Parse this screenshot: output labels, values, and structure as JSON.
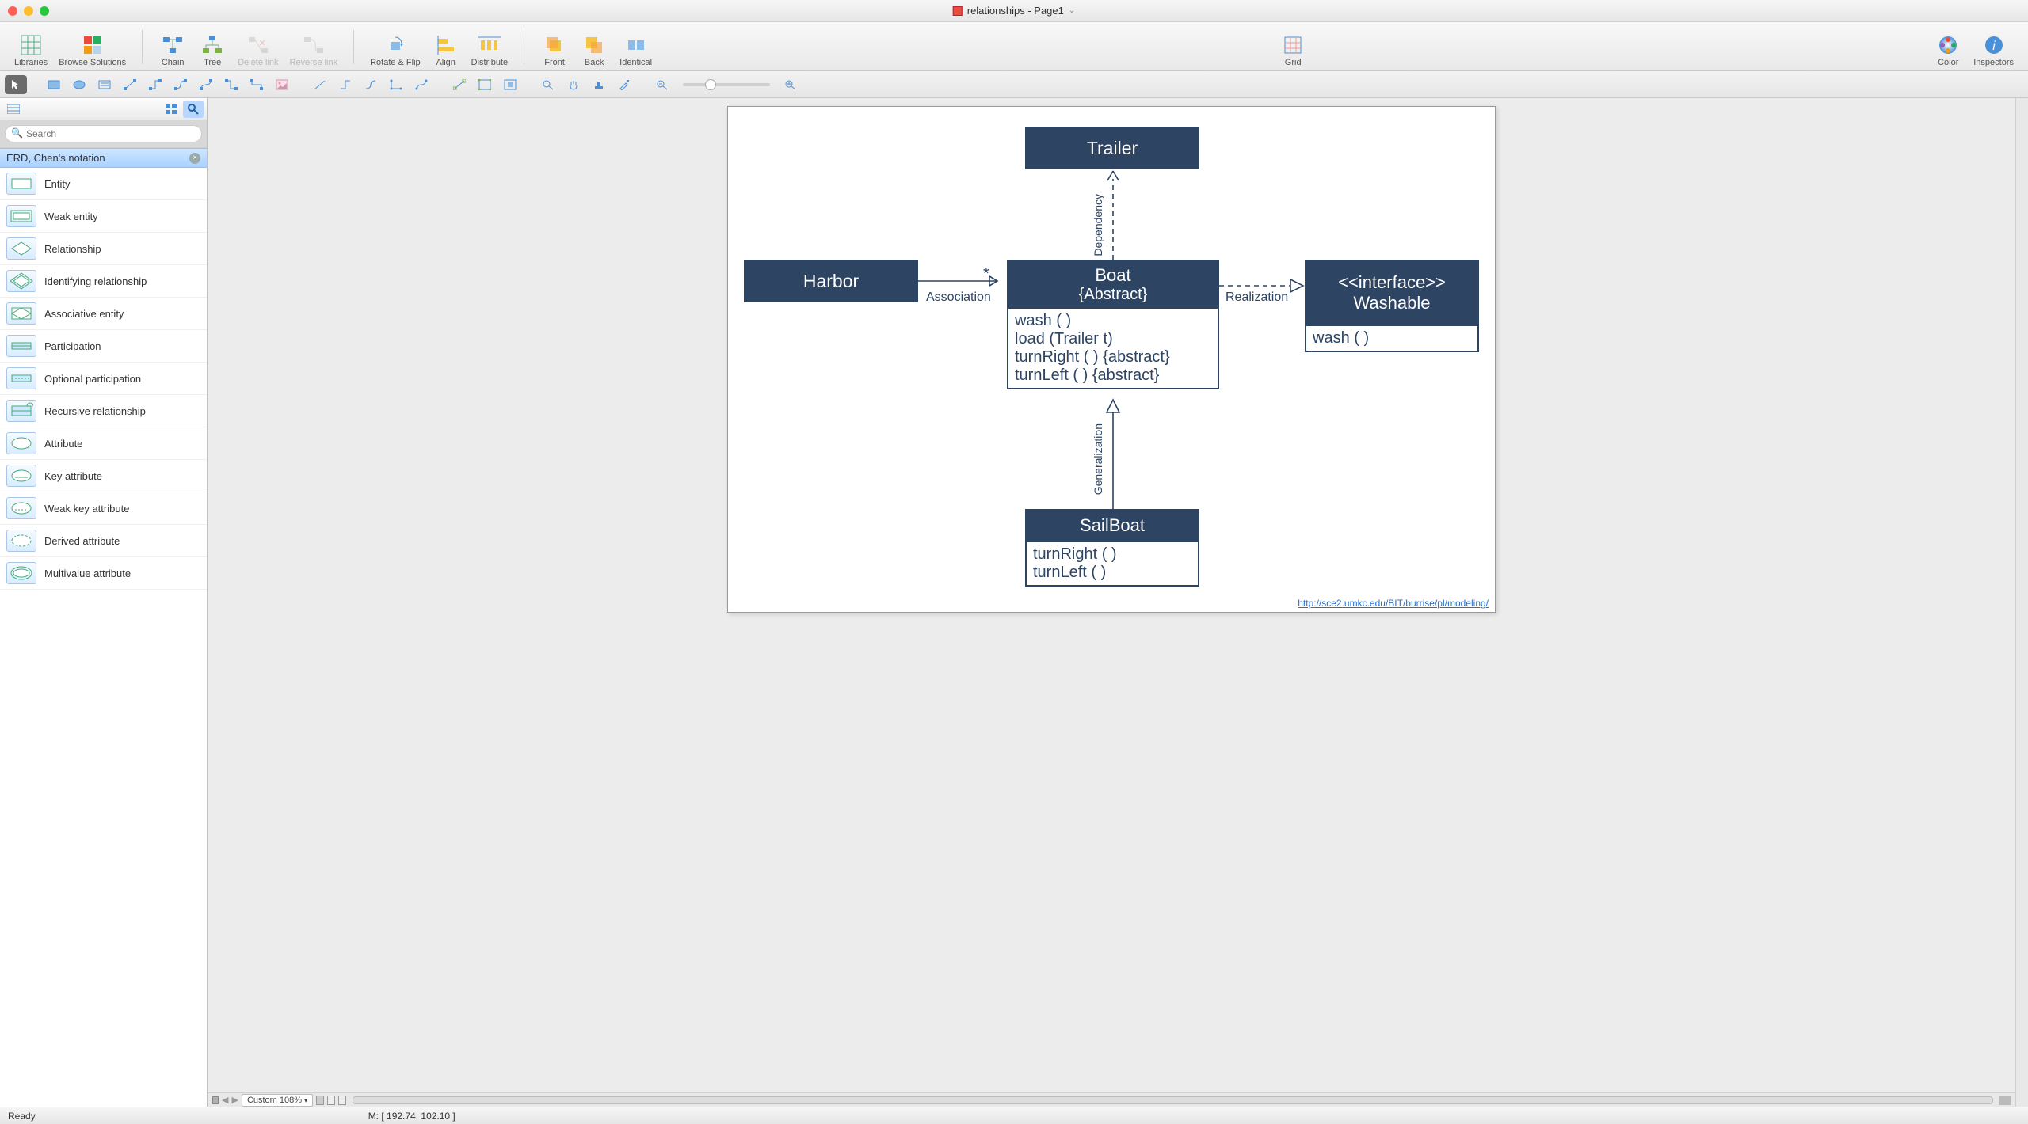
{
  "window": {
    "title": "relationships - Page1"
  },
  "toolbar": {
    "libraries": "Libraries",
    "browse": "Browse Solutions",
    "chain": "Chain",
    "tree": "Tree",
    "delete_link": "Delete link",
    "reverse_link": "Reverse link",
    "rotate_flip": "Rotate & Flip",
    "align": "Align",
    "distribute": "Distribute",
    "front": "Front",
    "back": "Back",
    "identical": "Identical",
    "grid": "Grid",
    "color": "Color",
    "inspectors": "Inspectors"
  },
  "search": {
    "placeholder": "Search"
  },
  "library": {
    "title": "ERD, Chen's notation",
    "items": [
      {
        "label": "Entity"
      },
      {
        "label": "Weak entity"
      },
      {
        "label": "Relationship"
      },
      {
        "label": "Identifying relationship"
      },
      {
        "label": "Associative entity"
      },
      {
        "label": "Participation"
      },
      {
        "label": "Optional participation"
      },
      {
        "label": "Recursive relationship"
      },
      {
        "label": "Attribute"
      },
      {
        "label": "Key attribute"
      },
      {
        "label": "Weak key attribute"
      },
      {
        "label": "Derived attribute"
      },
      {
        "label": "Multivalue attribute"
      }
    ]
  },
  "diagram": {
    "trailer": "Trailer",
    "harbor": "Harbor",
    "boat_title": "Boat",
    "boat_sub": "{Abstract}",
    "boat_ops": [
      "wash ( )",
      "load (Trailer t)",
      "turnRight ( ) {abstract}",
      "turnLeft ( ) {abstract}"
    ],
    "iface_stereo": "<<interface>>",
    "iface_name": "Washable",
    "iface_ops": [
      "wash ( )"
    ],
    "sailboat": "SailBoat",
    "sailboat_ops": [
      "turnRight ( )",
      "turnLeft ( )"
    ],
    "lbl_dependency": "Dependency",
    "lbl_association": "Association",
    "lbl_star": "*",
    "lbl_realization": "Realization",
    "lbl_generalization": "Generalization",
    "url": "http://sce2.umkc.edu/BIT/burrise/pl/modeling/"
  },
  "bottom": {
    "custom": "Custom 108%",
    "ready": "Ready",
    "mouse": "M: [ 192.74, 102.10 ]"
  },
  "chart_data": {
    "type": "uml-class-diagram",
    "classes": [
      {
        "name": "Trailer",
        "stereotype": null,
        "abstract": false,
        "operations": []
      },
      {
        "name": "Harbor",
        "stereotype": null,
        "abstract": false,
        "operations": []
      },
      {
        "name": "Boat",
        "stereotype": null,
        "abstract": true,
        "operations": [
          "wash()",
          "load(Trailer t)",
          "turnRight() {abstract}",
          "turnLeft() {abstract}"
        ]
      },
      {
        "name": "Washable",
        "stereotype": "interface",
        "abstract": false,
        "operations": [
          "wash()"
        ]
      },
      {
        "name": "SailBoat",
        "stereotype": null,
        "abstract": false,
        "operations": [
          "turnRight()",
          "turnLeft()"
        ]
      }
    ],
    "relationships": [
      {
        "from": "Harbor",
        "to": "Boat",
        "type": "Association",
        "to_multiplicity": "*"
      },
      {
        "from": "Boat",
        "to": "Trailer",
        "type": "Dependency"
      },
      {
        "from": "Boat",
        "to": "Washable",
        "type": "Realization"
      },
      {
        "from": "SailBoat",
        "to": "Boat",
        "type": "Generalization"
      }
    ],
    "source_url": "http://sce2.umkc.edu/BIT/burrise/pl/modeling/"
  }
}
